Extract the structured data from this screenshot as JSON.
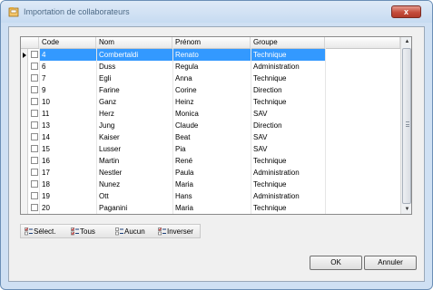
{
  "window": {
    "title": "Importation de collaborateurs",
    "close_glyph": "x"
  },
  "grid": {
    "columns": [
      "Code",
      "Nom",
      "Prénom",
      "Groupe"
    ],
    "rows": [
      {
        "code": "4",
        "nom": "Combertaldi",
        "prenom": "Renato",
        "groupe": "Technique"
      },
      {
        "code": "6",
        "nom": "Duss",
        "prenom": "Regula",
        "groupe": "Administration"
      },
      {
        "code": "7",
        "nom": "Egli",
        "prenom": "Anna",
        "groupe": "Technique"
      },
      {
        "code": "9",
        "nom": "Farine",
        "prenom": "Corine",
        "groupe": "Direction"
      },
      {
        "code": "10",
        "nom": "Ganz",
        "prenom": "Heinz",
        "groupe": "Technique"
      },
      {
        "code": "11",
        "nom": "Herz",
        "prenom": "Monica",
        "groupe": "SAV"
      },
      {
        "code": "13",
        "nom": "Jung",
        "prenom": "Claude",
        "groupe": "Direction"
      },
      {
        "code": "14",
        "nom": "Kaiser",
        "prenom": "Beat",
        "groupe": "SAV"
      },
      {
        "code": "15",
        "nom": "Lusser",
        "prenom": "Pia",
        "groupe": "SAV"
      },
      {
        "code": "16",
        "nom": "Martin",
        "prenom": "René",
        "groupe": "Technique"
      },
      {
        "code": "17",
        "nom": "Nestler",
        "prenom": "Paula",
        "groupe": "Administration"
      },
      {
        "code": "18",
        "nom": "Nunez",
        "prenom": "Maria",
        "groupe": "Technique"
      },
      {
        "code": "19",
        "nom": "Ott",
        "prenom": "Hans",
        "groupe": "Administration"
      },
      {
        "code": "20",
        "nom": "Paganini",
        "prenom": "Maria",
        "groupe": "Technique"
      }
    ],
    "selected_row": 0
  },
  "scrollbar": {
    "up_glyph": "▲",
    "down_glyph": "▼"
  },
  "toolbar": {
    "select_label": "Sélect.",
    "all_label": "Tous",
    "none_label": "Aucun",
    "invert_label": "Inverser"
  },
  "buttons": {
    "ok": "OK",
    "cancel": "Annuler"
  },
  "colors": {
    "selection": "#3399ff",
    "close": "#c54d3c",
    "check_red": "#c62828"
  }
}
